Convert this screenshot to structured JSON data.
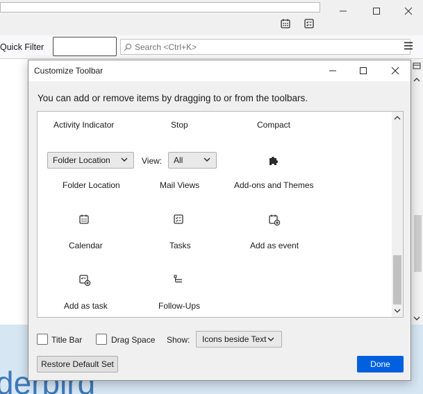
{
  "background": {
    "quick_filter_label": "Quick Filter",
    "search_placeholder": "Search <Ctrl+K>",
    "brand_fragment": "derbird"
  },
  "dialog": {
    "title": "Customize Toolbar",
    "description": "You can add or remove items by dragging to or from the toolbars.",
    "palette": {
      "row1": [
        "Activity Indicator",
        "Stop",
        "Compact"
      ],
      "folder_location_value": "Folder Location",
      "view_label": "View:",
      "view_value": "All",
      "row2": [
        "Folder Location",
        "Mail Views",
        "Add-ons and Themes"
      ],
      "row3": [
        "Calendar",
        "Tasks",
        "Add as event"
      ],
      "row4": [
        "Add as task",
        "Follow-Ups"
      ]
    },
    "options": {
      "title_bar_label": "Title Bar",
      "title_bar_checked": false,
      "drag_space_label": "Drag Space",
      "drag_space_checked": false,
      "show_label": "Show:",
      "show_value": "Icons beside Text"
    },
    "buttons": {
      "restore": "Restore Default Set",
      "done": "Done"
    }
  },
  "colors": {
    "accent": "#0060df",
    "brand_text": "#3e78b9"
  }
}
